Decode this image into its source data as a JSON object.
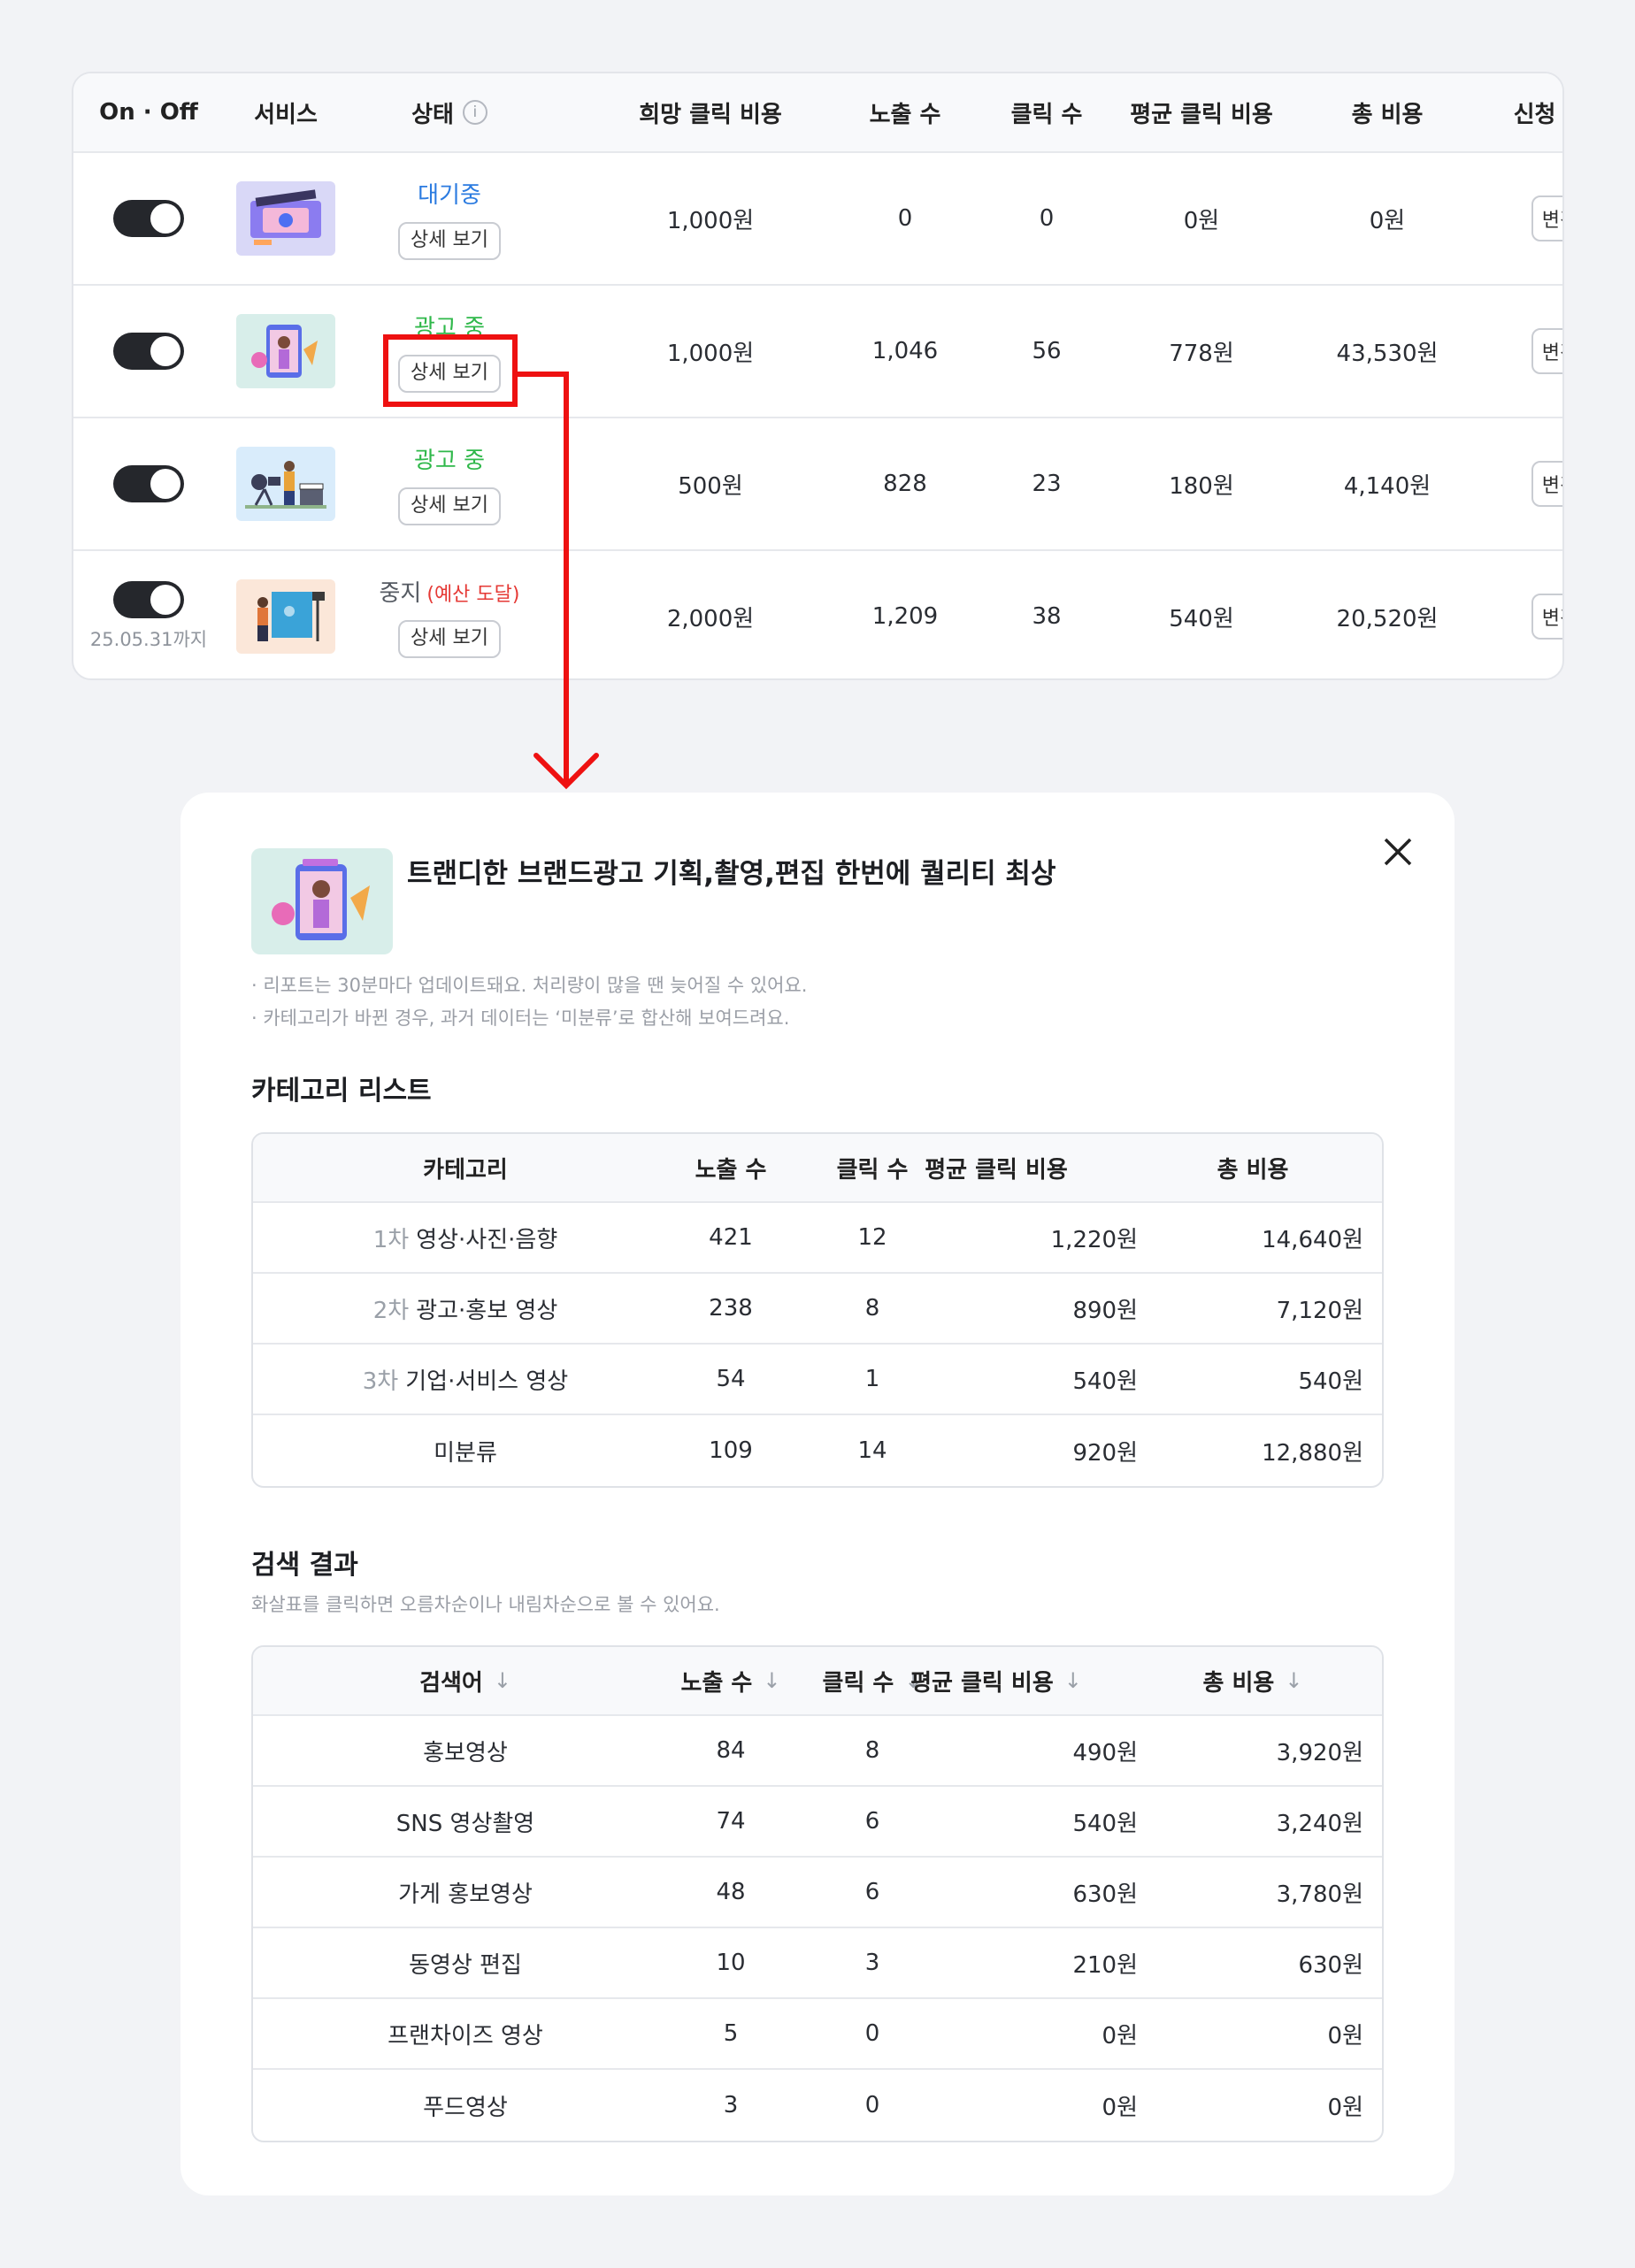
{
  "ads_table": {
    "headers": {
      "toggle": "On · Off",
      "service": "서비스",
      "status": "상태",
      "bid": "희망 클릭 비용",
      "impressions": "노출 수",
      "clicks": "클릭 수",
      "avg_cpc": "평균 클릭 비용",
      "total_cost": "총 비용",
      "application": "신청 정보"
    },
    "rows": [
      {
        "status": "대기중",
        "status_note": "",
        "detail": "상세 보기",
        "bid": "1,000원",
        "impressions": "0",
        "clicks": "0",
        "avg_cpc": "0원",
        "total_cost": "0원",
        "change": "변경",
        "toggle_note": ""
      },
      {
        "status": "광고 중",
        "status_note": "",
        "detail": "상세 보기",
        "bid": "1,000원",
        "impressions": "1,046",
        "clicks": "56",
        "avg_cpc": "778원",
        "total_cost": "43,530원",
        "change": "변경",
        "toggle_note": ""
      },
      {
        "status": "광고 중",
        "status_note": "",
        "detail": "상세 보기",
        "bid": "500원",
        "impressions": "828",
        "clicks": "23",
        "avg_cpc": "180원",
        "total_cost": "4,140원",
        "change": "변경",
        "toggle_note": ""
      },
      {
        "status": "중지",
        "status_note": "(예산 도달)",
        "detail": "상세 보기",
        "bid": "2,000원",
        "impressions": "1,209",
        "clicks": "38",
        "avg_cpc": "540원",
        "total_cost": "20,520원",
        "change": "변경",
        "toggle_note": "25.05.31까지"
      }
    ]
  },
  "modal": {
    "title": "트랜디한 브랜드광고 기획,촬영,편집 한번에 퀄리티 최상",
    "notes": [
      "· 리포트는 30분마다 업데이트돼요. 처리량이 많을 땐 늦어질 수 있어요.",
      "· 카테고리가 바뀐 경우, 과거 데이터는 ‘미분류’로 합산해 보여드려요."
    ],
    "category_section": {
      "title": "카테고리 리스트",
      "headers": {
        "category": "카테고리",
        "impressions": "노출 수",
        "clicks": "클릭 수",
        "avg_cpc": "평균 클릭 비용",
        "total_cost": "총 비용"
      },
      "rows": [
        {
          "level": "1차",
          "name": "영상·사진·음향",
          "impressions": "421",
          "clicks": "12",
          "avg_cpc": "1,220원",
          "total_cost": "14,640원"
        },
        {
          "level": "2차",
          "name": "광고·홍보 영상",
          "impressions": "238",
          "clicks": "8",
          "avg_cpc": "890원",
          "total_cost": "7,120원"
        },
        {
          "level": "3차",
          "name": "기업·서비스 영상",
          "impressions": "54",
          "clicks": "1",
          "avg_cpc": "540원",
          "total_cost": "540원"
        },
        {
          "level": "",
          "name": "미분류",
          "impressions": "109",
          "clicks": "14",
          "avg_cpc": "920원",
          "total_cost": "12,880원"
        }
      ]
    },
    "search_section": {
      "title": "검색 결과",
      "subtitle": "화살표를 클릭하면 오름차순이나 내림차순으로 볼 수 있어요.",
      "headers": {
        "keyword": "검색어",
        "impressions": "노출 수",
        "clicks": "클릭 수",
        "avg_cpc": "평균 클릭 비용",
        "total_cost": "총 비용"
      },
      "rows": [
        {
          "keyword": "홍보영상",
          "impressions": "84",
          "clicks": "8",
          "avg_cpc": "490원",
          "total_cost": "3,920원"
        },
        {
          "keyword": "SNS 영상촬영",
          "impressions": "74",
          "clicks": "6",
          "avg_cpc": "540원",
          "total_cost": "3,240원"
        },
        {
          "keyword": "가게 홍보영상",
          "impressions": "48",
          "clicks": "6",
          "avg_cpc": "630원",
          "total_cost": "3,780원"
        },
        {
          "keyword": "동영상 편집",
          "impressions": "10",
          "clicks": "3",
          "avg_cpc": "210원",
          "total_cost": "630원"
        },
        {
          "keyword": "프랜차이즈 영상",
          "impressions": "5",
          "clicks": "0",
          "avg_cpc": "0원",
          "total_cost": "0원"
        },
        {
          "keyword": "푸드영상",
          "impressions": "3",
          "clicks": "0",
          "avg_cpc": "0원",
          "total_cost": "0원"
        }
      ]
    }
  },
  "colors": {
    "status_waiting": "#2b7be0",
    "status_active": "#2fb84a",
    "status_budget_reached": "#e53935",
    "highlight": "#ee1111",
    "toggle_on": "#25272c"
  },
  "icons": {
    "info": "info-icon",
    "close": "close-icon",
    "sort": "arrow-down-icon"
  }
}
